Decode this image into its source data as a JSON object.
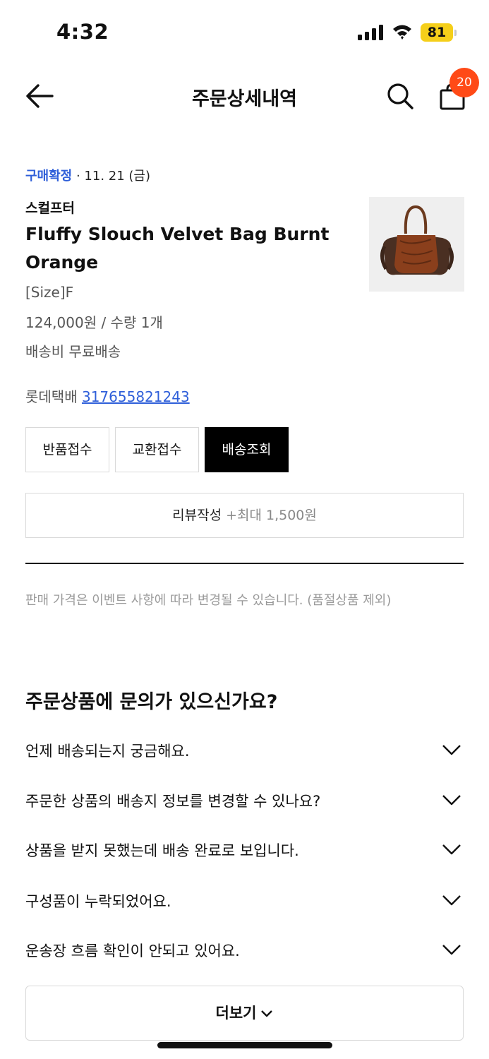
{
  "status_bar": {
    "time": "4:32",
    "battery": "81"
  },
  "header": {
    "title": "주문상세내역",
    "cart_count": "20"
  },
  "order": {
    "status": "구매확정",
    "date": " · 11. 21 (금)",
    "brand": "스컬프터",
    "product_name": "Fluffy Slouch Velvet Bag Burnt Orange",
    "option": "[Size]F",
    "price_qty": "124,000원 / 수량 1개",
    "shipping_fee": "배송비 무료배송",
    "carrier": "롯데택배",
    "tracking_number": "317655821243"
  },
  "actions": {
    "return": "반품접수",
    "exchange": "교환접수",
    "track": "배송조회"
  },
  "review": {
    "label": "리뷰작성",
    "bonus": "+최대 1,500원"
  },
  "price_notice": "판매 가격은 이벤트 사항에 따라 변경될 수 있습니다. (품절상품 제외)",
  "faq": {
    "title": "주문상품에 문의가 있으신가요?",
    "items": [
      {
        "label": "언제 배송되는지 궁금해요."
      },
      {
        "label": "주문한 상품의 배송지 정보를 변경할 수 있나요?"
      },
      {
        "label": "상품을 받지 못했는데 배송 완료로 보입니다."
      },
      {
        "label": "구성품이 누락되었어요."
      },
      {
        "label": "운송장 흐름 확인이 안되고 있어요."
      }
    ],
    "more": "더보기"
  },
  "colors": {
    "link": "#2f5fd9",
    "badge": "#ff4a17",
    "battery": "#f5cf1a"
  },
  "icons": [
    "signal-icon",
    "wifi-icon",
    "battery-icon",
    "back-arrow-icon",
    "search-icon",
    "shopping-bag-icon",
    "chevron-down-icon"
  ]
}
